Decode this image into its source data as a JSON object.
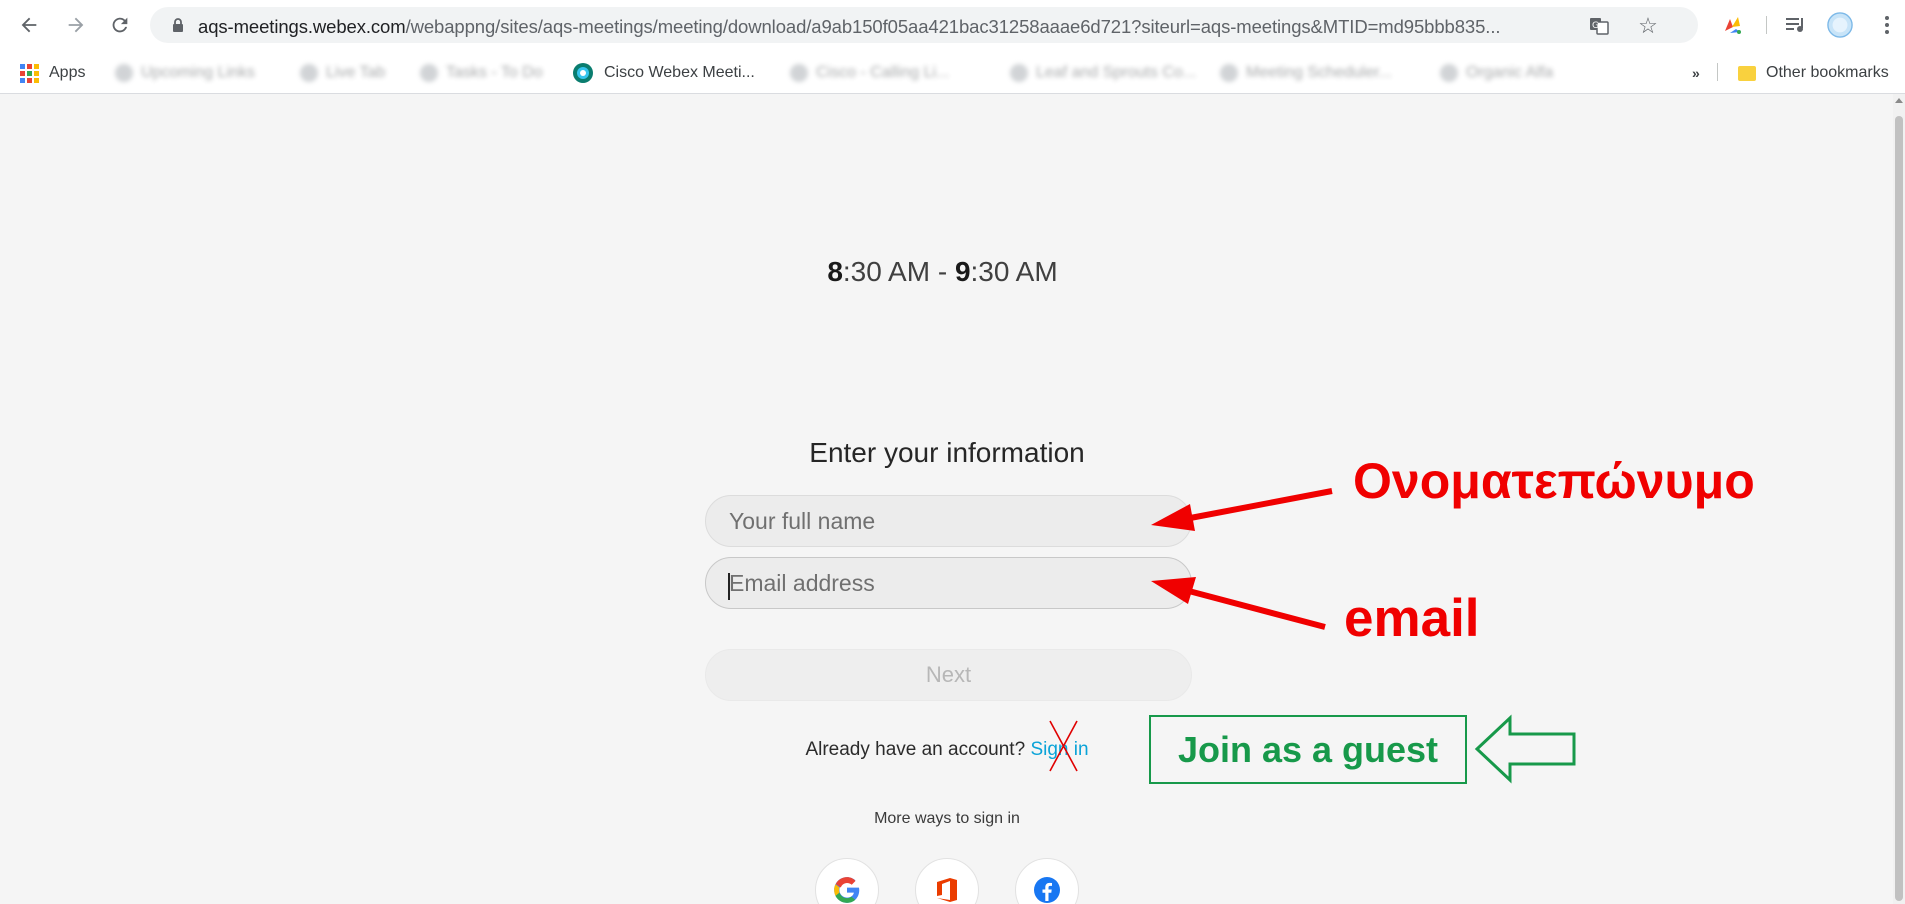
{
  "browser": {
    "url_host": "aqs-meetings.webex.com",
    "url_path": "/webappng/sites/aqs-meetings/meeting/download/a9ab150f05aa421bac31258aaae6d721?siteurl=aqs-meetings&MTID=md95bbb835...",
    "bookmarks": {
      "apps_label": "Apps",
      "cisco_label": "Cisco Webex Meeti...",
      "more_label": "»",
      "other_label": "Other bookmarks",
      "blurred": [
        "Upcoming Links",
        "Live Tab",
        "Tasks - To Do",
        "Cisco - Calling Li...",
        "Leaf and Sprouts Co...",
        "Meeting Scheduler...",
        "Organic Alfa"
      ]
    },
    "icons": {
      "back": "arrow-left-icon",
      "forward": "arrow-right-icon",
      "reload": "reload-icon",
      "lock": "lock-icon",
      "translate": "translate-icon",
      "star": "star-icon",
      "extension": "extension-icon",
      "media": "media-icon",
      "profile": "profile-icon",
      "menu": "kebab-menu-icon"
    }
  },
  "meeting": {
    "time_start_bold": "8",
    "time_start_rest": ":30 AM - ",
    "time_end_bold": "9",
    "time_end_rest": ":30 AM"
  },
  "form": {
    "title": "Enter your information",
    "name_placeholder": "Your full name",
    "email_placeholder": "Email address",
    "next_label": "Next",
    "account_question": "Already have an account?",
    "sign_in_link": "Sign in",
    "more_ways": "More ways to sign in",
    "social": [
      "Google",
      "Office 365",
      "Facebook"
    ]
  },
  "annotations": {
    "name_label": "Ονοματεπώνυμο",
    "email_label": "email",
    "guest_label": "Join as a guest",
    "colors": {
      "red": "#f00000",
      "green": "#17994a"
    }
  }
}
